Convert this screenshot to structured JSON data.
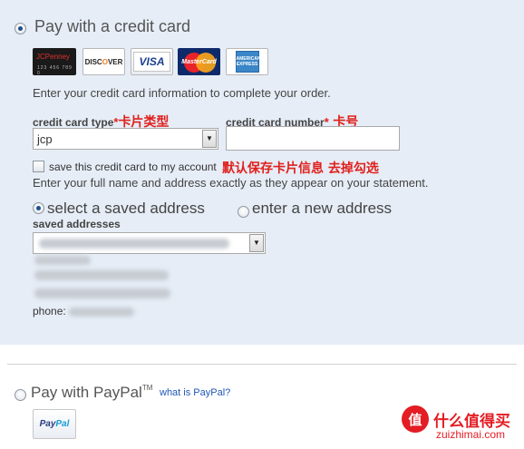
{
  "credit_card": {
    "title": "Pay with a credit card",
    "selected": true,
    "cards": [
      {
        "name": "jcpenney-card",
        "label": "JCPenney",
        "number": "123 456 789 0"
      },
      {
        "name": "discover-card",
        "label": "DISC",
        "label2": "O",
        "label3": "VER"
      },
      {
        "name": "visa-card",
        "label": "VISA"
      },
      {
        "name": "mastercard-card",
        "label": "MasterCard"
      },
      {
        "name": "amex-card",
        "label": "AMERICAN EXPRESS"
      }
    ],
    "instruction": "Enter your credit card information to complete your order.",
    "type_label": "credit card type",
    "type_required": "*",
    "type_annotation": "卡片类型",
    "type_value": "jcp",
    "number_label": "credit card number",
    "number_required": "*",
    "number_annotation": "卡号",
    "number_value": "",
    "save_label": "save this credit card to my account",
    "save_checked": false,
    "save_annotation": "默认保存卡片信息 去掉勾选",
    "address_instruction": "Enter your full name and address exactly as they appear on your statement.",
    "select_saved_label": "select a saved address",
    "enter_new_label": "enter a new address",
    "saved_addresses_label": "saved addresses",
    "phone_label": "phone:"
  },
  "paypal": {
    "title": "Pay with PayPal",
    "tm": "TM",
    "link": "what is PayPal?",
    "logo_label": "Pay",
    "logo_label2": "Pal"
  },
  "watermark": {
    "badge": "值",
    "title": "什么值得买",
    "domain": "zuizhimai.com"
  },
  "colors": {
    "panel_bg": "#e6edf6",
    "annotation_red": "#e0201c",
    "link_blue": "#1f57b4",
    "watermark_red": "#e41c23"
  }
}
